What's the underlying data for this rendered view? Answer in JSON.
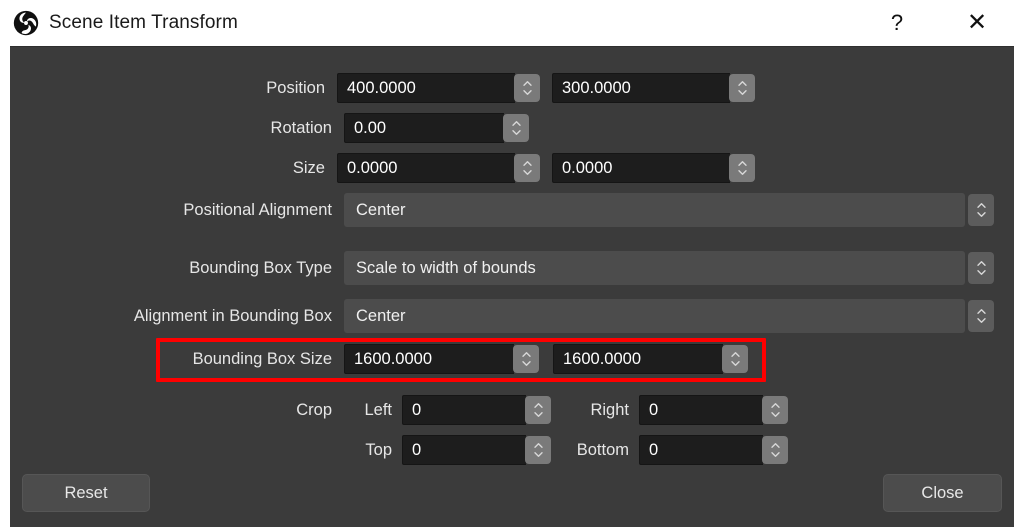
{
  "window": {
    "title": "Scene Item Transform",
    "logo_icon": "obs-logo-icon",
    "help_label": "?",
    "close_label": "✕"
  },
  "form": {
    "rows": [
      {
        "label": "Position",
        "type": "spin-pair",
        "value1": "400.0000",
        "value2": "300.0000"
      },
      {
        "label": "Rotation",
        "type": "spin-single",
        "value1": "0.00"
      },
      {
        "label": "Size",
        "type": "spin-pair",
        "value1": "0.0000",
        "value2": "0.0000"
      },
      {
        "label": "Positional Alignment",
        "type": "combo",
        "value1": "Center"
      },
      {
        "label": "Bounding Box Type",
        "type": "combo",
        "value1": "Scale to width of bounds"
      },
      {
        "label": "Alignment in Bounding Box",
        "type": "combo",
        "value1": "Center"
      },
      {
        "label": "Bounding Box Size",
        "type": "spin-pair",
        "value1": "1600.0000",
        "value2": "1600.0000",
        "highlighted": true
      }
    ]
  },
  "crop": {
    "label": "Crop",
    "left_label": "Left",
    "left_value": "0",
    "right_label": "Right",
    "right_value": "0",
    "top_label": "Top",
    "top_value": "0",
    "bottom_label": "Bottom",
    "bottom_value": "0"
  },
  "footer": {
    "reset_label": "Reset",
    "close_label": "Close"
  },
  "annotation": {
    "color": "#ff0000",
    "target": "Bounding Box Size"
  }
}
